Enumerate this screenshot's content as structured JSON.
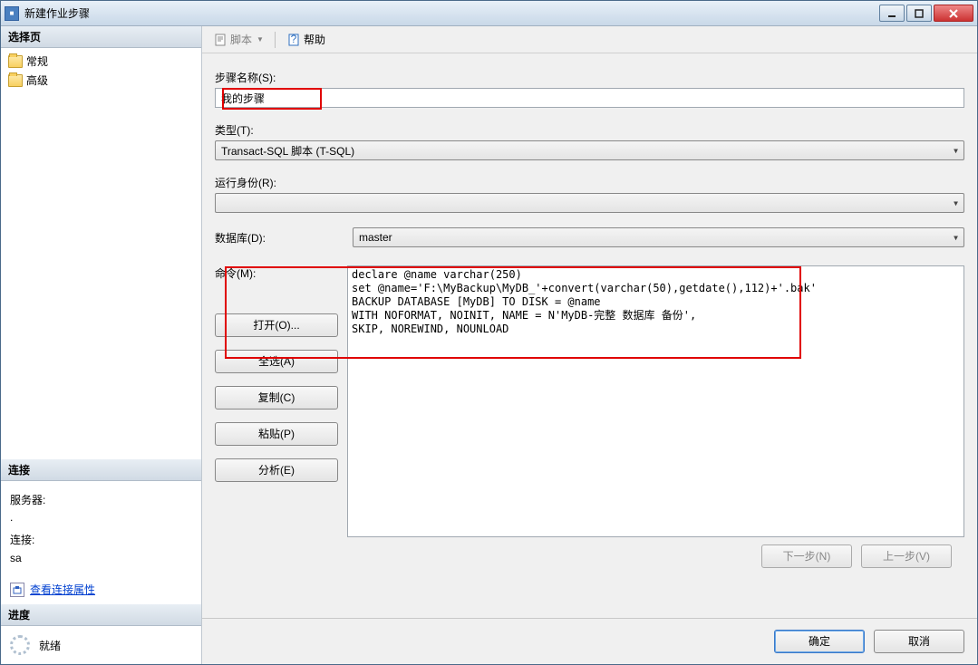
{
  "titlebar": {
    "title": "新建作业步骤"
  },
  "sidebar": {
    "select_page_header": "选择页",
    "nav": [
      {
        "label": "常规"
      },
      {
        "label": "高级"
      }
    ],
    "connection_header": "连接",
    "connection": {
      "server_label": "服务器:",
      "server_value": ".",
      "conn_label": "连接:",
      "conn_value": "sa",
      "view_props": "查看连接属性"
    },
    "progress_header": "进度",
    "progress_status": "就绪"
  },
  "toolbar": {
    "script": "脚本",
    "help": "帮助"
  },
  "form": {
    "step_name_label": "步骤名称(S):",
    "step_name_value": "我的步骤",
    "type_label": "类型(T):",
    "type_value": "Transact-SQL 脚本 (T-SQL)",
    "runas_label": "运行身份(R):",
    "runas_value": "",
    "database_label": "数据库(D):",
    "database_value": "master",
    "command_label": "命令(M):",
    "command_text": "declare @name varchar(250)\nset @name='F:\\MyBackup\\MyDB_'+convert(varchar(50),getdate(),112)+'.bak'\nBACKUP DATABASE [MyDB] TO DISK = @name\nWITH NOFORMAT, NOINIT, NAME = N'MyDB-完整 数据库 备份',\nSKIP, NOREWIND, NOUNLOAD",
    "buttons": {
      "open": "打开(O)...",
      "select_all": "全选(A)",
      "copy": "复制(C)",
      "paste": "粘贴(P)",
      "parse": "分析(E)"
    },
    "nav": {
      "next": "下一步(N)",
      "prev": "上一步(V)"
    }
  },
  "footer": {
    "ok": "确定",
    "cancel": "取消"
  }
}
